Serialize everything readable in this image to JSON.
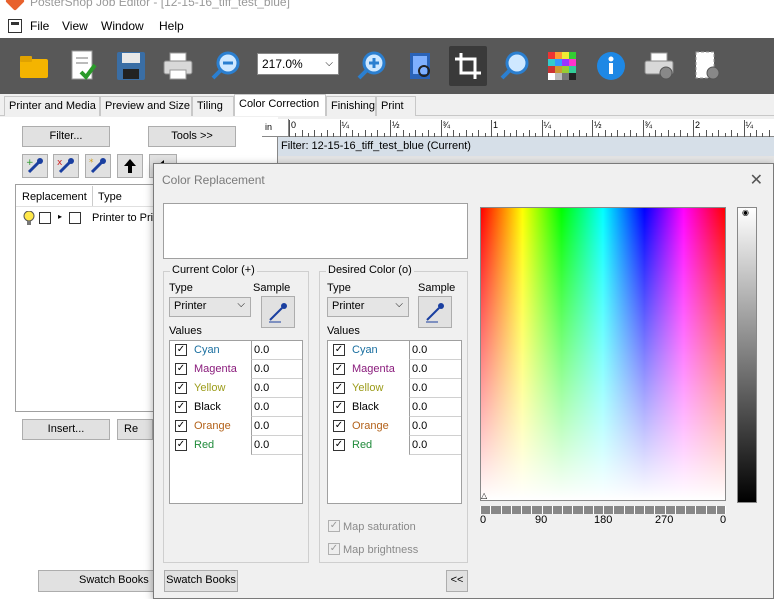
{
  "window": {
    "title": "PosterShop Job Editor - [12-15-16_tiff_test_blue]"
  },
  "menu": {
    "items": [
      "File",
      "View",
      "Window",
      "Help"
    ]
  },
  "toolbar": {
    "zoom_value": "217.0%"
  },
  "tabs": [
    "Printer and Media",
    "Preview and Size",
    "Tiling",
    "Color Correction",
    "Finishing",
    "Print"
  ],
  "left_panel": {
    "filter_button": "Filter...",
    "tools_button": "Tools >>",
    "list_headers": [
      "Replacement",
      "Type"
    ],
    "list_row_type": "Printer to Pri",
    "insert_button": "Insert...",
    "re_button": "Re",
    "swatch_books_button": "Swatch Books"
  },
  "ruler": {
    "unit": "in",
    "labels": [
      "0",
      "¼",
      "½",
      "¾",
      "1",
      "¼",
      "½",
      "¾",
      "2",
      "¼",
      "½"
    ]
  },
  "filter_bar": {
    "text": "Filter: 12-15-16_tiff_test_blue (Current)"
  },
  "dialog": {
    "title": "Color Replacement",
    "current": {
      "label": "Current Color (+)",
      "type_label": "Type",
      "sample_label": "Sample",
      "type_value": "Printer",
      "values_label": "Values",
      "rows": [
        {
          "name": "Cyan",
          "value": "0.0",
          "color": "#1a6fa0"
        },
        {
          "name": "Magenta",
          "value": "0.0",
          "color": "#8a1c7c"
        },
        {
          "name": "Yellow",
          "value": "0.0",
          "color": "#9c9c1a"
        },
        {
          "name": "Black",
          "value": "0.0",
          "color": "#000000"
        },
        {
          "name": "Orange",
          "value": "0.0",
          "color": "#b3621a"
        },
        {
          "name": "Red",
          "value": "0.0",
          "color": "#1f8a3a"
        }
      ]
    },
    "desired": {
      "label": "Desired Color (o)",
      "type_label": "Type",
      "sample_label": "Sample",
      "type_value": "Printer",
      "values_label": "Values",
      "rows": [
        {
          "name": "Cyan",
          "value": "0.0",
          "color": "#1a6fa0"
        },
        {
          "name": "Magenta",
          "value": "0.0",
          "color": "#8a1c7c"
        },
        {
          "name": "Yellow",
          "value": "0.0",
          "color": "#9c9c1a"
        },
        {
          "name": "Black",
          "value": "0.0",
          "color": "#000000"
        },
        {
          "name": "Orange",
          "value": "0.0",
          "color": "#b3621a"
        },
        {
          "name": "Red",
          "value": "0.0",
          "color": "#1f8a3a"
        }
      ]
    },
    "map_saturation": "Map saturation",
    "map_brightness": "Map brightness",
    "swatch_books_button": "Swatch Books",
    "collapse_button": "<<",
    "hue_axis_labels": [
      "0",
      "90",
      "180",
      "270",
      "0"
    ]
  }
}
